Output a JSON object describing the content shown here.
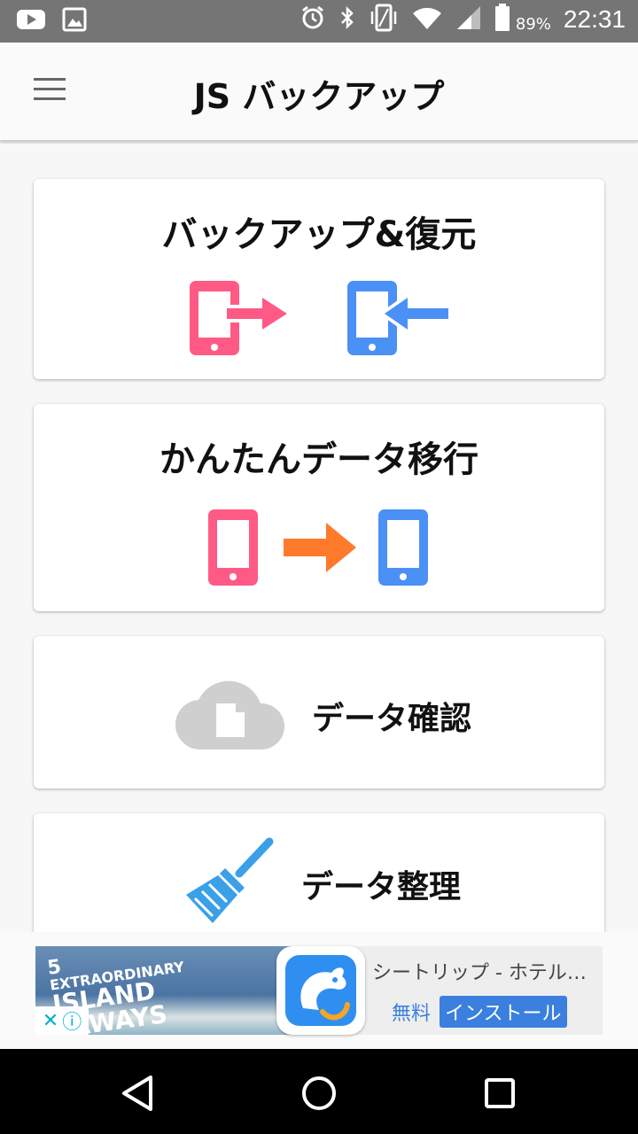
{
  "status_bar": {
    "time": "22:31",
    "battery": "89%",
    "icons": [
      "youtube-icon",
      "image-icon",
      "alarm-icon",
      "bluetooth-icon",
      "vibrate-icon",
      "wifi-icon",
      "signal-icon",
      "battery-icon"
    ]
  },
  "app_bar": {
    "title": "JS バックアップ",
    "menu_icon": "hamburger-menu-icon"
  },
  "cards": [
    {
      "title": "バックアップ&復元",
      "icons": [
        "phone-export-icon",
        "phone-import-icon"
      ]
    },
    {
      "title": "かんたんデータ移行",
      "icons": [
        "phone-source-icon",
        "transfer-arrow-icon",
        "phone-target-icon"
      ]
    },
    {
      "title": "データ確認",
      "icons": [
        "cloud-document-icon"
      ]
    },
    {
      "title": "データ整理",
      "icons": [
        "broom-icon"
      ]
    }
  ],
  "ad": {
    "image_number": "5",
    "image_line1": "EXTRAORDINARY",
    "image_line2": "ISLAND",
    "image_line3": "TAWAYS",
    "app_name": "シートリップ - ホテル…",
    "free_label": "無料",
    "install_label": "インストール",
    "close_icon": "close-icon",
    "info_icon": "info-icon"
  },
  "colors": {
    "pink": "#ff5a86",
    "blue": "#4a90f5",
    "orange": "#ff7a2a",
    "gray_cloud": "#cfcfcf",
    "broom_blue": "#3aa0e8"
  },
  "nav_bar": {
    "buttons": [
      "back-icon",
      "home-icon",
      "recents-icon"
    ]
  }
}
